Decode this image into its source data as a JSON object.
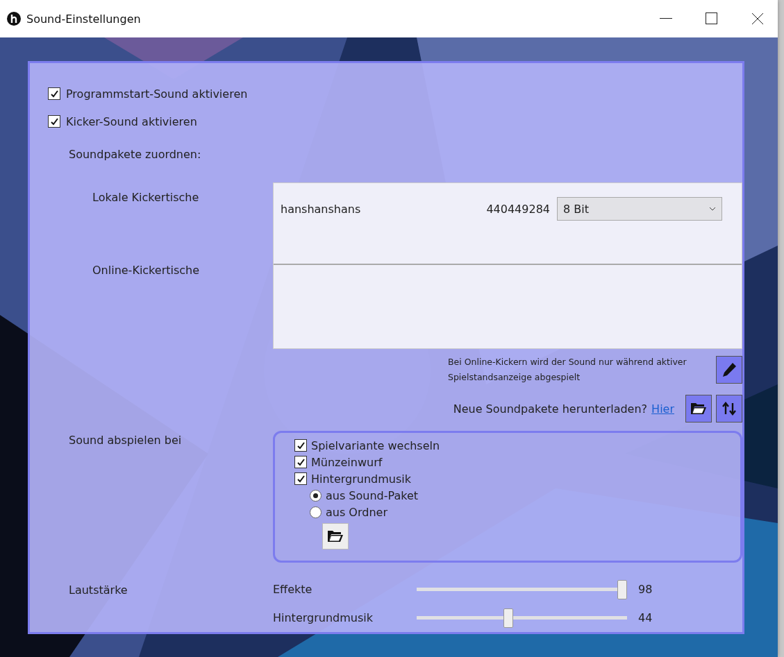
{
  "window": {
    "title": "Sound-Einstellungen"
  },
  "options": [
    {
      "label": "Programmstart-Sound aktivieren",
      "checked": true
    },
    {
      "label": "Kicker-Sound aktivieren",
      "checked": true
    }
  ],
  "assign_label": "Soundpakete zuordnen:",
  "local_tables": {
    "label": "Lokale Kickertische",
    "rows": [
      {
        "name": "hanshanshans",
        "number": "440449284",
        "package": "8 Bit"
      }
    ]
  },
  "online_tables": {
    "label": "Online-Kickertische"
  },
  "note": "Bei Online-Kickern wird der Sound nur während aktiver Spielstandsanzeige abgespielt",
  "download": {
    "text": "Neue Soundpakete herunterladen?",
    "link": "Hier"
  },
  "play_sound": {
    "label": "Sound abspielen bei",
    "events": [
      {
        "label": "Spielvariante wechseln",
        "checked": true
      },
      {
        "label": "Münzeinwurf",
        "checked": true
      },
      {
        "label": "Hintergrundmusik",
        "checked": true
      }
    ],
    "music_source": [
      {
        "label": "aus Sound-Paket",
        "selected": true
      },
      {
        "label": "aus Ordner",
        "selected": false
      }
    ]
  },
  "volume": {
    "label": "Lautstärke",
    "sliders": [
      {
        "label": "Effekte",
        "level": 0.98,
        "reading": "98"
      },
      {
        "label": "Hintergrundmusik",
        "level": 0.44,
        "reading": "44"
      }
    ]
  }
}
